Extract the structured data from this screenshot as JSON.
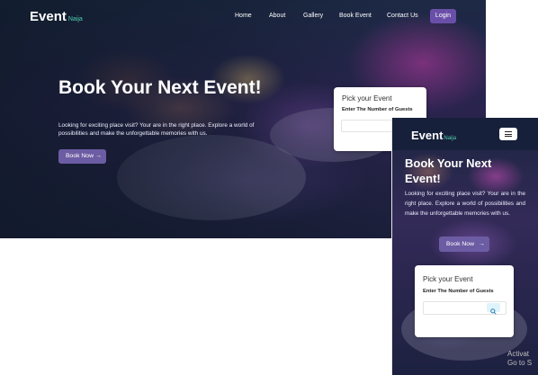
{
  "brand": {
    "name": "Event",
    "sub": "Naija"
  },
  "nav": {
    "items": [
      "Home",
      "About",
      "Gallery",
      "Book Event",
      "Contact Us"
    ],
    "login": "Login"
  },
  "hero": {
    "title": "Book Your Next Event!",
    "description": "Looking for exciting place visit? Your are in the right place. Explore a world of possibilities and make the unforgettable memories with us.",
    "cta": "Book Now",
    "cta_icon": "arrow-right-icon"
  },
  "booking_card": {
    "title": "Pick your Event",
    "guests_label": "Enter The Number of Guests",
    "search_icon": "search-icon"
  },
  "mobile_menu_icon": "hamburger-icon",
  "watermark": {
    "line1": "Activat",
    "line2": "Go to S"
  },
  "colors": {
    "accent": "#6c5ca3",
    "brand_sub": "#4fd0b0",
    "nav_bg": "#17203a"
  }
}
